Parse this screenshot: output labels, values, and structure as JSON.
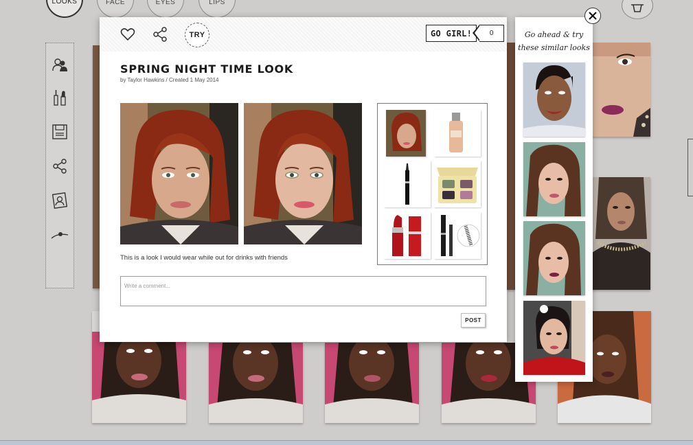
{
  "top_tabs": [
    {
      "label": "LOOKS",
      "active": true
    },
    {
      "label": "FACE",
      "active": false
    },
    {
      "label": "EYES",
      "active": false
    },
    {
      "label": "LIPS",
      "active": false
    }
  ],
  "left_rail_icons": [
    "users-icon",
    "makeup-tools-icon",
    "save-icon",
    "share-icon",
    "profile-photo-icon",
    "slider-icon"
  ],
  "modal": {
    "try_label": "TRY",
    "gogirl_label": "GO GIRL!",
    "gogirl_count": "0",
    "title": "SPRING NIGHT TIME LOOK",
    "byline_prefix": "by ",
    "author": "Taylor Hawkins",
    "byline_suffix": " / Created 1 May 2014",
    "description": "This is a look I would wear while out for drinks with friends",
    "comment_placeholder": "Write a comment...",
    "post_label": "POST"
  },
  "similar": {
    "title_line1": "Go ahead & try",
    "title_line2": "these similar looks"
  },
  "colors": {
    "modal_bg": "#ffffff",
    "page_bg": "#cfcdcb",
    "accent_text": "#222222"
  }
}
